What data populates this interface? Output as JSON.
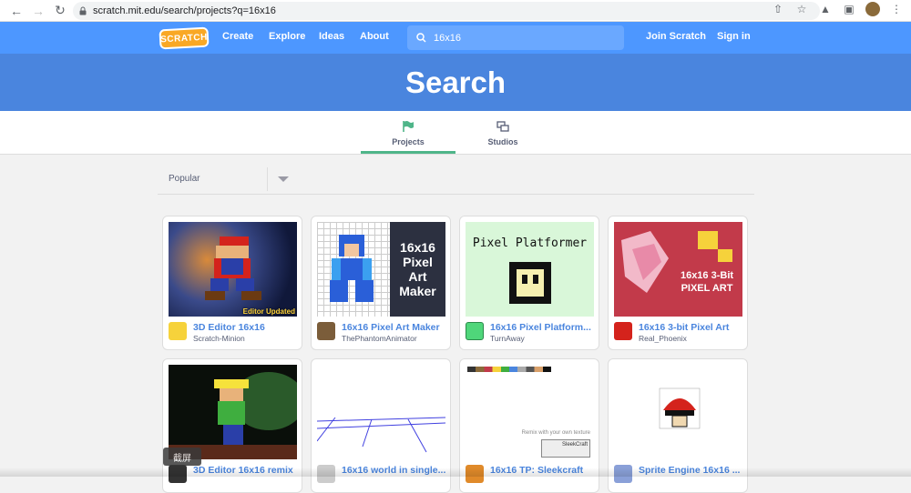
{
  "browser": {
    "url": "scratch.mit.edu/search/projects?q=16x16"
  },
  "navbar": {
    "logo_text": "SCRATCH",
    "links": [
      "Create",
      "Explore",
      "Ideas",
      "About"
    ],
    "search_value": "16x16",
    "join": "Join Scratch",
    "signin": "Sign in"
  },
  "hero": {
    "title": "Search"
  },
  "tabs": [
    {
      "label": "Projects",
      "icon": "flag-icon",
      "active": true
    },
    {
      "label": "Studios",
      "icon": "studios-icon",
      "active": false
    }
  ],
  "filter": {
    "selected": "Popular"
  },
  "projects": [
    {
      "title": "3D Editor 16x16",
      "author": "Scratch-Minion",
      "badge": "Editor Updated"
    },
    {
      "title": "16x16 Pixel Art Maker",
      "author": "ThePhantomAnimator",
      "thumb_text": "16x16 Pixel Art Maker"
    },
    {
      "title": "16x16 Pixel Platform...",
      "author": "TurnAway",
      "thumb_text": "Pixel Platformer"
    },
    {
      "title": "16x16 3-bit Pixel Art",
      "author": "Real_Phoenix",
      "thumb_text": "16x16 3-Bit PIXEL ART"
    },
    {
      "title": "3D Editor 16x16 remix",
      "author": ""
    },
    {
      "title": "16x16 world in single...",
      "author": ""
    },
    {
      "title": "16x16 TP: Sleekcraft",
      "author": "",
      "thumb_text": "Remix with your own texture",
      "thumb_sub": "SleekCraft"
    },
    {
      "title": "Sprite Engine 16x16 ...",
      "author": ""
    }
  ],
  "tooltip": "截屏",
  "colors": {
    "navbar": "#4d97ff",
    "hero": "#4a85de",
    "accent": "#4fb589",
    "link": "#4a85de"
  }
}
